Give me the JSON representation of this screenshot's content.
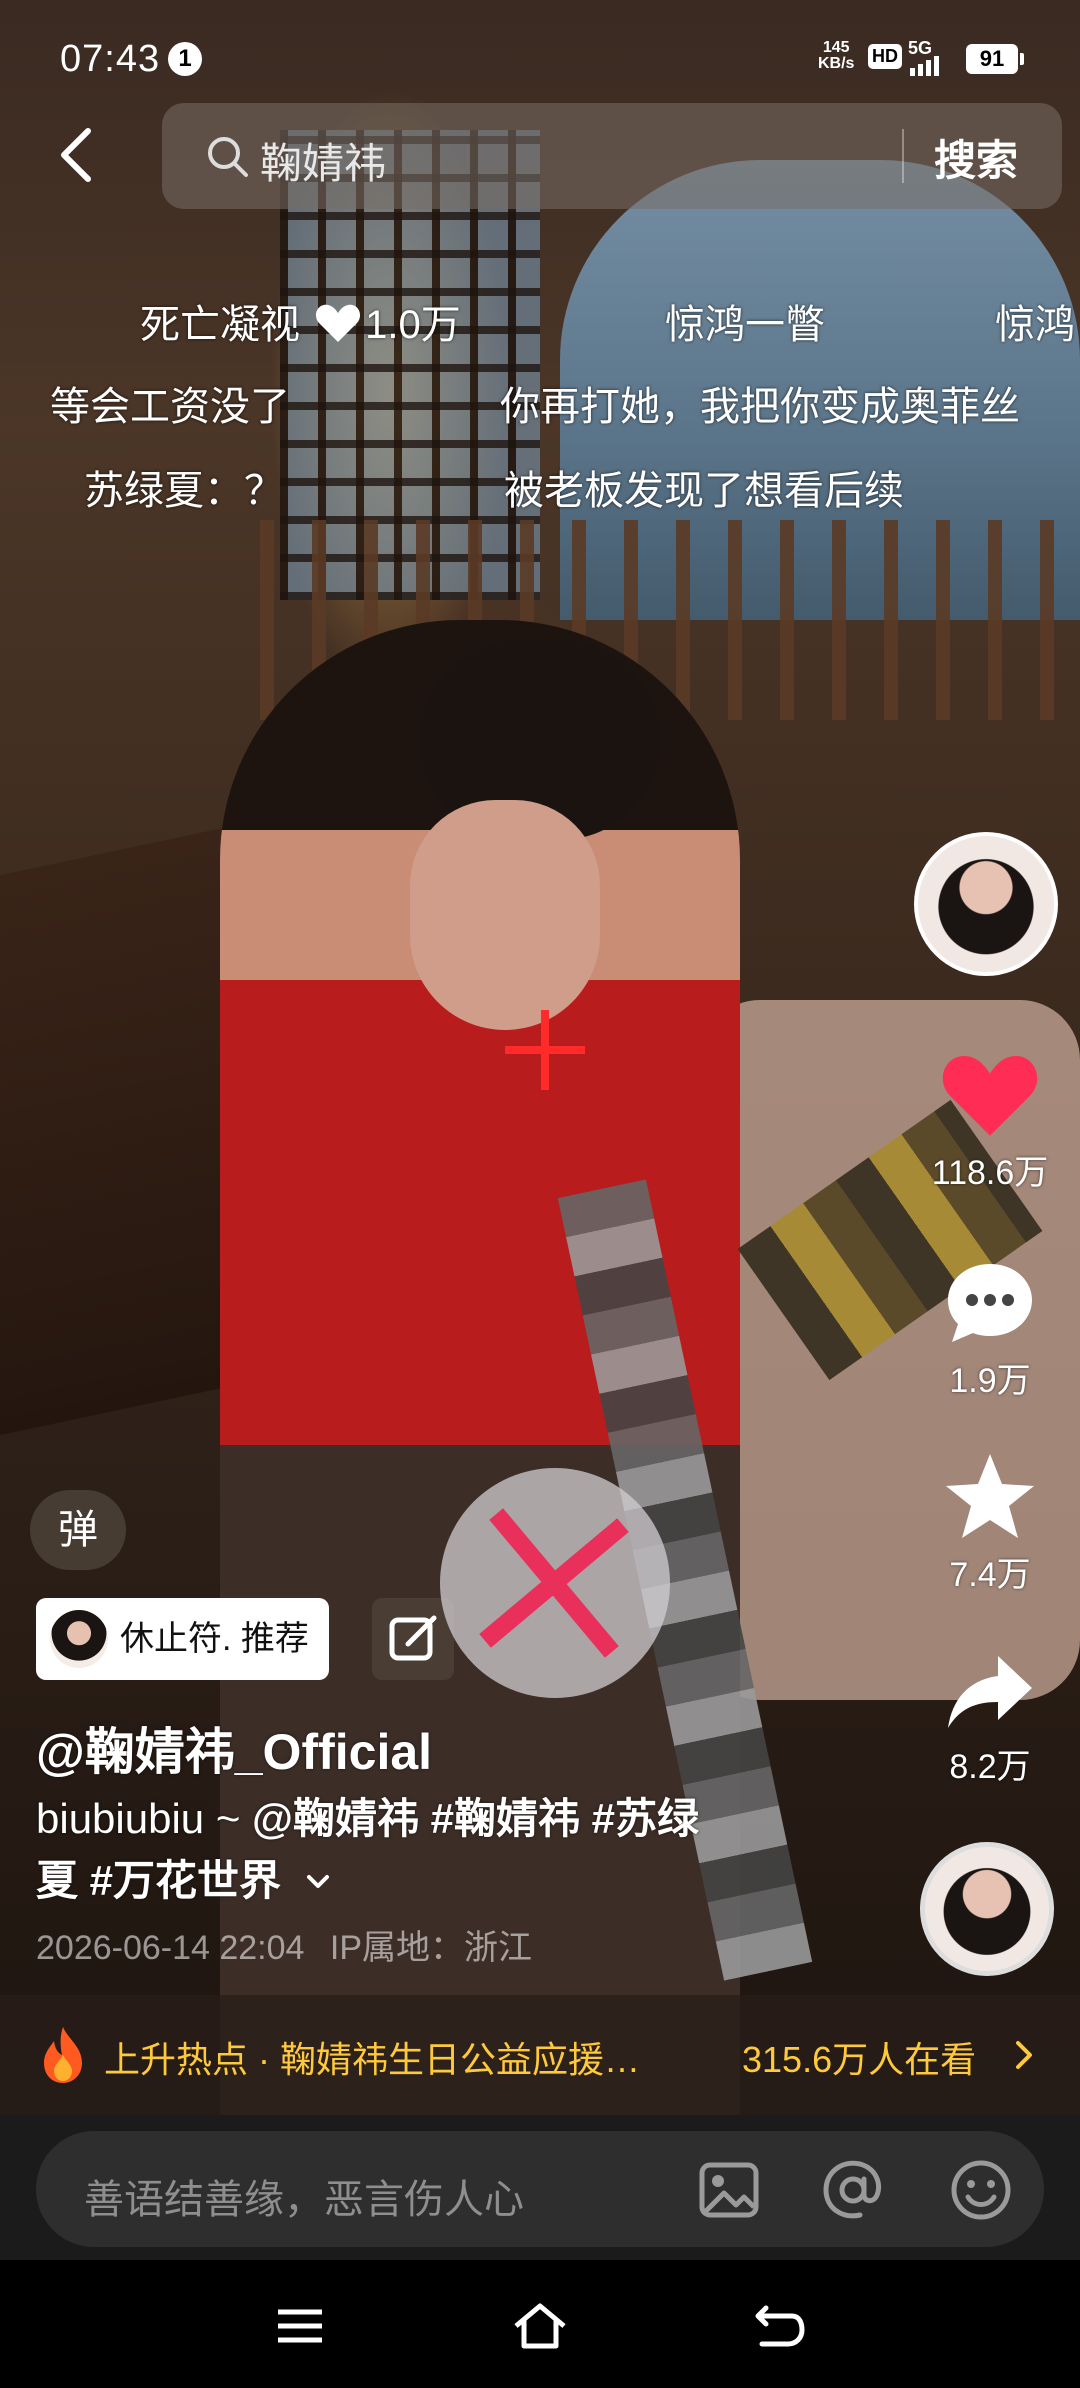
{
  "status_bar": {
    "time": "07:43",
    "notification_count": "1",
    "net_speed_value": "145",
    "net_speed_unit": "KB/s",
    "hd": "HD",
    "signal": "5G",
    "battery": "91"
  },
  "search": {
    "query": "鞠婧祎",
    "button": "搜索"
  },
  "danmaku": [
    {
      "text": "死亡凝视"
    },
    {
      "text": "1.0万"
    },
    {
      "text": "惊鸿一瞥"
    },
    {
      "text": "惊鸿"
    },
    {
      "text": "等会工资没了"
    },
    {
      "text": "你再打她，我把你变成奥菲丝"
    },
    {
      "text": "苏绿夏：？"
    },
    {
      "text": "被老板发现了想看后续"
    }
  ],
  "actions": {
    "likes": "118.6万",
    "comments": "1.9万",
    "favorites": "7.4万",
    "shares": "8.2万"
  },
  "overlay": {
    "danmu_toggle": "弹",
    "tag_chip": "休止符. 推荐"
  },
  "post": {
    "handle": "@鞠婧祎_Official",
    "desc_prefix": "biubiubiu ~ ",
    "desc_tags_line1": "@鞠婧祎 #鞠婧祎 #苏绿",
    "desc_tags_line2": "夏 #万花世界",
    "date": "2026-06-14 22:04",
    "ip_location": "IP属地：浙江"
  },
  "hot_topic": {
    "text": "上升热点 · 鞠婧祎生日公益应援…",
    "watching": "315.6万人在看"
  },
  "comment": {
    "placeholder": "善语结善缘，恶言伤人心"
  },
  "colors": {
    "accent_like": "#ff2c55",
    "hot_text": "#ffc93c",
    "comment_bg": "#1b1b1b"
  }
}
